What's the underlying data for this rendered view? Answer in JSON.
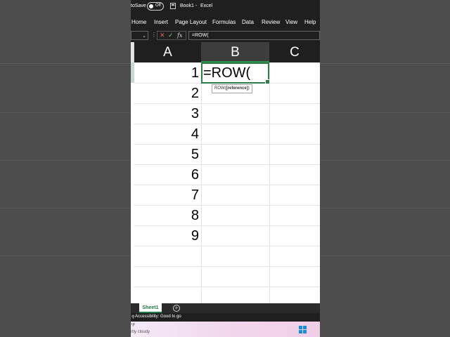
{
  "titlebar": {
    "autosave_label": "toSave",
    "autosave_state": "Off",
    "book_name": "Book1",
    "separator": "-",
    "app_name": "Excel"
  },
  "ribbon_tabs": [
    "Home",
    "Insert",
    "Page Layout",
    "Formulas",
    "Data",
    "Review",
    "View",
    "Help"
  ],
  "formula_bar": {
    "namebox_value": "",
    "cancel_icon": "✕",
    "enter_icon": "✓",
    "fx_label": "fx",
    "formula": "=ROW("
  },
  "grid": {
    "columns": [
      "A",
      "B",
      "C"
    ],
    "active_column": "B",
    "column_a_values": [
      "1",
      "2",
      "3",
      "4",
      "5",
      "6",
      "7",
      "8",
      "9"
    ],
    "active_cell_value": "=ROW(",
    "tooltip_func": "ROW(",
    "tooltip_arg": "[reference]",
    "tooltip_close": ")"
  },
  "sheet_tabs": [
    "Sheet1"
  ],
  "statusbar": {
    "accessibility": "Accessibility: Good to go"
  },
  "taskbar": {
    "weather_temp": "°F",
    "weather_desc": "rtly cloudy"
  },
  "colors": {
    "accent": "#2e7d48",
    "chrome": "#1f1f1f",
    "outside": "#4d4d4d"
  },
  "icons": [
    "autosave-toggle-icon",
    "save-icon",
    "cancel-icon",
    "enter-icon",
    "fx-icon",
    "add-sheet-icon",
    "accessibility-icon",
    "windows-start-icon"
  ]
}
